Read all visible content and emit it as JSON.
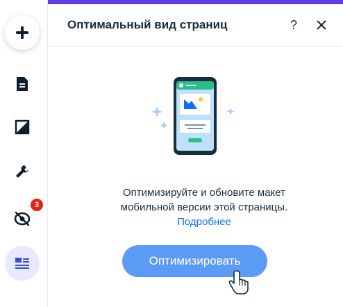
{
  "sidebar": {
    "items": [
      {
        "icon": "plus-icon"
      },
      {
        "icon": "page-icon"
      },
      {
        "icon": "design-icon"
      },
      {
        "icon": "wrench-icon"
      },
      {
        "icon": "hidden-eye-icon",
        "badge": "3"
      },
      {
        "icon": "layout-icon"
      }
    ]
  },
  "panel": {
    "title": "Оптимальный вид страниц",
    "help": "?",
    "description": "Оптимизируйте и обновите макет мобильной версии этой страницы.",
    "link": "Подробнее",
    "button": "Оптимизировать"
  },
  "colors": {
    "accent_bar": "#5f3ee8",
    "button": "#5c9bf5",
    "link": "#116dff",
    "badge": "#e62214"
  }
}
